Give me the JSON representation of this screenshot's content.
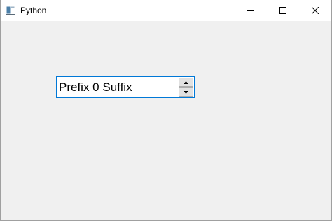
{
  "window": {
    "title": "Python",
    "accent_color": "#0078d7",
    "background_color": "#f0f0f0"
  },
  "titlebar_buttons": {
    "minimize_icon": "minimize-icon",
    "maximize_icon": "maximize-icon",
    "close_icon": "close-icon"
  },
  "spinbox": {
    "value": "Prefix 0 Suffix",
    "up_icon": "arrow-up-icon",
    "down_icon": "arrow-down-icon"
  }
}
